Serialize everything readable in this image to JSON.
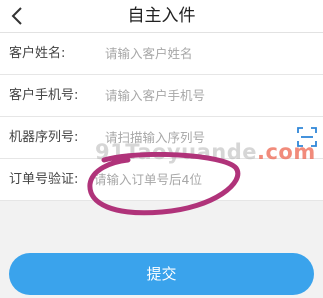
{
  "header": {
    "title": "自主入件",
    "back_icon": "chevron-left-icon"
  },
  "form": {
    "rows": [
      {
        "label": "客户姓名:",
        "placeholder": "请输入客户姓名",
        "value": ""
      },
      {
        "label": "客户手机号:",
        "placeholder": "请输入客户手机号",
        "value": ""
      },
      {
        "label": "机器序列号:",
        "placeholder": "请扫描输入序列号",
        "value": "",
        "icon": "scan-icon"
      },
      {
        "label": "订单号验证:",
        "placeholder": "请输入订单号后4位",
        "value": ""
      }
    ]
  },
  "watermark": {
    "text": "91Taoyuande",
    "suffix": ".com"
  },
  "submit": {
    "label": "提交"
  },
  "colors": {
    "accent": "#3aa3ec",
    "scan_icon": "#2f86d8",
    "annotation": "#b0337a"
  }
}
